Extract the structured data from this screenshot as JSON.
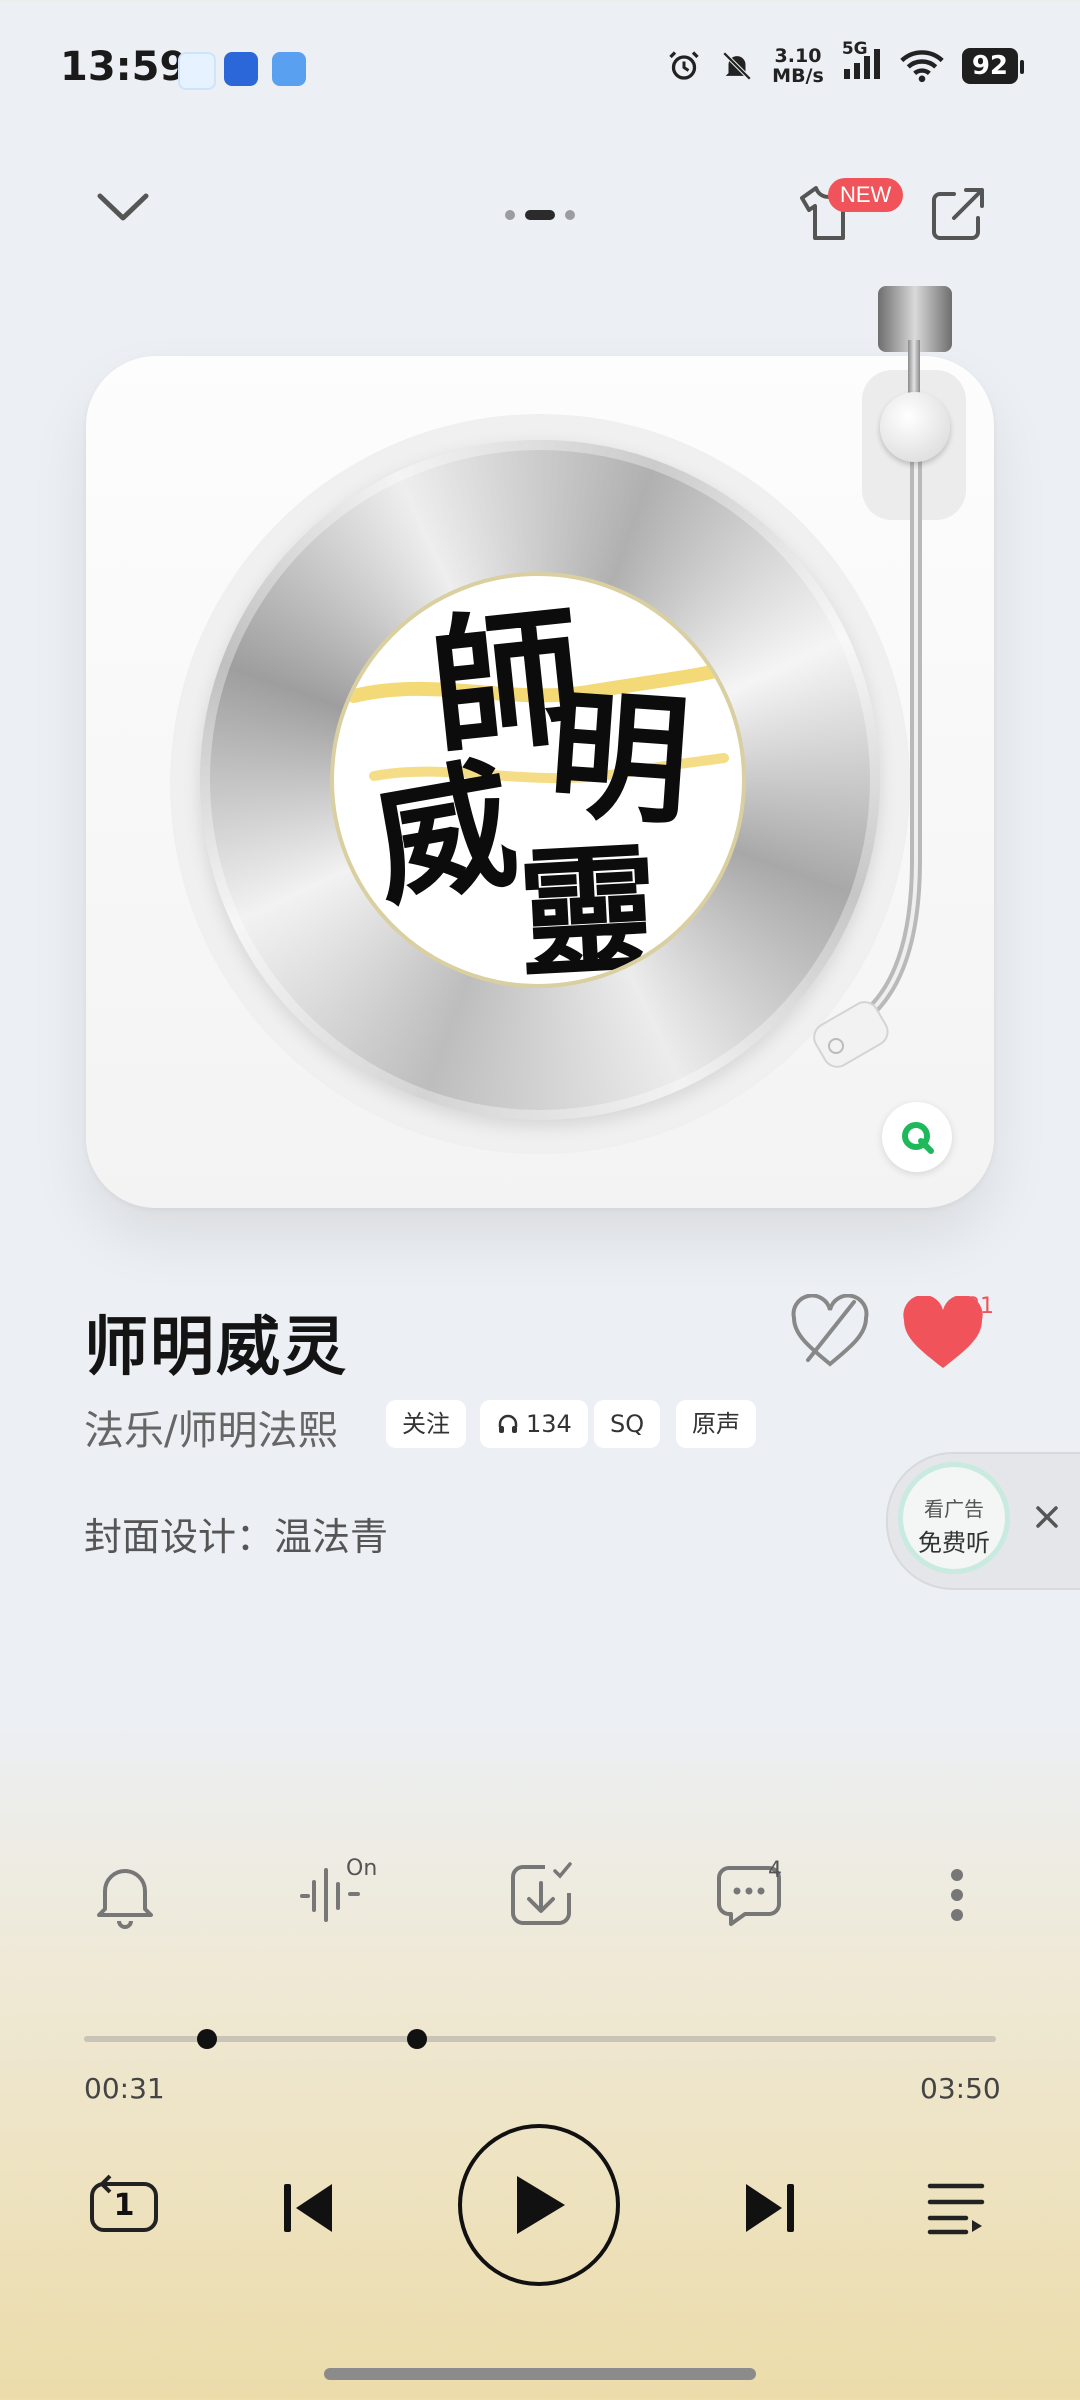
{
  "status_bar": {
    "time": "13:59",
    "net_speed_value": "3.10",
    "net_speed_unit": "MB/s",
    "network": "5G",
    "battery": "92"
  },
  "top_bar": {
    "new_badge": "NEW"
  },
  "song": {
    "title": "师明威灵",
    "artist": "法乐/师明法熙",
    "chips": [
      "关注",
      "134",
      "SQ",
      "原声"
    ],
    "like_count": "31",
    "cover_design": "封面设计：温法青"
  },
  "album_art": {
    "lines": [
      "師",
      "明",
      "威",
      "靈"
    ]
  },
  "ad": {
    "line1": "看广告",
    "line2": "免费听"
  },
  "actions": {
    "sound_effect_state": "On",
    "comment_count": "4"
  },
  "progress": {
    "current": "00:31",
    "total": "03:50",
    "played_fraction": 0.135,
    "marker_fraction": 0.365
  },
  "controls": {
    "repeat_mode": "1"
  },
  "colors": {
    "accent_red": "#f0545a",
    "brand_green": "#1fb85a"
  }
}
